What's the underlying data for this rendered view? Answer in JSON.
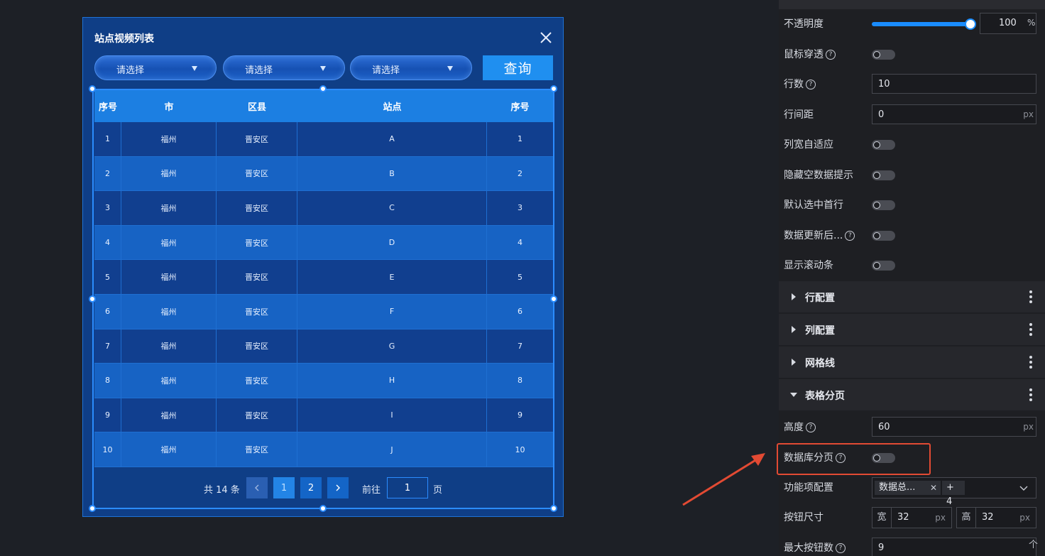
{
  "dialog": {
    "title": "站点视频列表",
    "selects": [
      "请选择",
      "请选择",
      "请选择"
    ],
    "query_label": "查询",
    "table": {
      "headers": [
        "序号",
        "市",
        "区县",
        "站点",
        "序号"
      ],
      "rows": [
        [
          "1",
          "福州",
          "晋安区",
          "A",
          "1"
        ],
        [
          "2",
          "福州",
          "晋安区",
          "B",
          "2"
        ],
        [
          "3",
          "福州",
          "晋安区",
          "C",
          "3"
        ],
        [
          "4",
          "福州",
          "晋安区",
          "D",
          "4"
        ],
        [
          "5",
          "福州",
          "晋安区",
          "E",
          "5"
        ],
        [
          "6",
          "福州",
          "晋安区",
          "F",
          "6"
        ],
        [
          "7",
          "福州",
          "晋安区",
          "G",
          "7"
        ],
        [
          "8",
          "福州",
          "晋安区",
          "H",
          "8"
        ],
        [
          "9",
          "福州",
          "晋安区",
          "I",
          "9"
        ],
        [
          "10",
          "福州",
          "晋安区",
          "J",
          "10"
        ]
      ]
    },
    "pager": {
      "total": "共 14 条",
      "pages": [
        "1",
        "2"
      ],
      "goto_label": "前往",
      "goto_value": "1",
      "page_suffix": "页"
    }
  },
  "panel": {
    "opacity": {
      "label": "不透明度",
      "value": "100",
      "unit": "%",
      "level_percent": 100
    },
    "mouse_through": {
      "label": "鼠标穿透"
    },
    "rows_count": {
      "label": "行数",
      "value": "10"
    },
    "row_spacing": {
      "label": "行间距",
      "value": "0",
      "unit": "px"
    },
    "col_autofit": {
      "label": "列宽自适应"
    },
    "hide_empty_tip": {
      "label": "隐藏空数据提示"
    },
    "default_select_first": {
      "label": "默认选中首行"
    },
    "after_data_update": {
      "label": "数据更新后..."
    },
    "show_scrollbar": {
      "label": "显示滚动条"
    },
    "sections": [
      "行配置",
      "列配置",
      "网格线",
      "表格分页"
    ],
    "height": {
      "label": "高度",
      "value": "60",
      "unit": "px"
    },
    "db_pagination": {
      "label": "数据库分页"
    },
    "features": {
      "label": "功能项配置",
      "tag1": "数据总...",
      "tag2": "+ 4"
    },
    "button_size": {
      "label": "按钮尺寸",
      "w_prefix": "宽",
      "w_value": "32",
      "h_prefix": "高",
      "h_value": "32",
      "unit": "px"
    },
    "max_buttons": {
      "label": "最大按钮数",
      "value": "9",
      "stepper": "个"
    }
  },
  "colors": {
    "accent": "#1a8cff",
    "dialog_bg": "#0f3e86",
    "highlight": "#e24a33"
  }
}
